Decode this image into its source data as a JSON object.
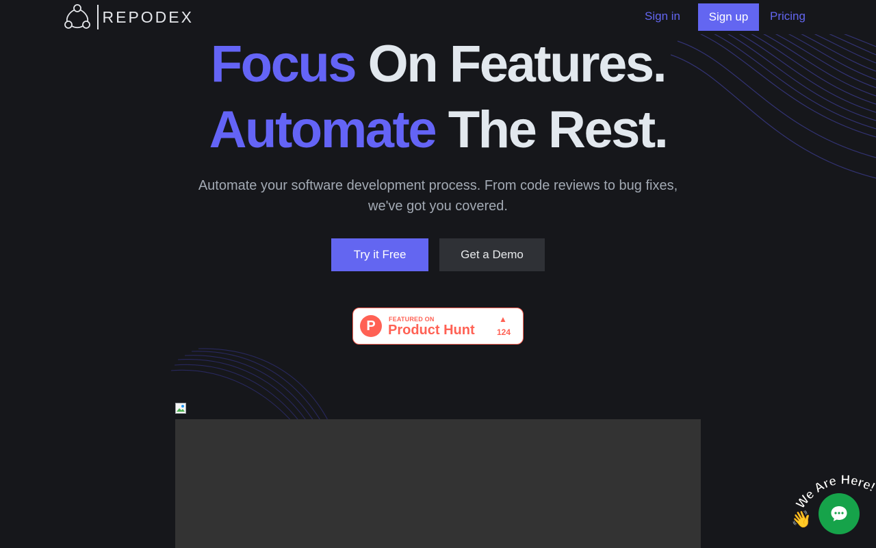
{
  "brand": {
    "name": "REPODEX"
  },
  "nav": {
    "sign_in": "Sign in",
    "sign_up": "Sign up",
    "pricing": "Pricing"
  },
  "hero": {
    "line1_accent": "Focus",
    "line1_rest": "On Features.",
    "line2_accent": "Automate",
    "line2_rest": "The Rest.",
    "subtitle_line1": "Automate your software development process. From code reviews to bug fixes,",
    "subtitle_line2": "we've got you covered."
  },
  "cta": {
    "primary_label": "Try it Free",
    "secondary_label": "Get a Demo"
  },
  "product_hunt": {
    "logo_letter": "P",
    "featured_label": "FEATURED ON",
    "title": "Product Hunt",
    "upvote_icon": "triangle-up-icon",
    "upvotes": "124"
  },
  "chat_widget": {
    "tagline": "We Are Here!",
    "hand_icon": "waving-hand-icon",
    "button_icon": "chat-bubble-icon"
  },
  "colors": {
    "background": "#16171b",
    "accent": "#6366f1",
    "product_hunt": "#ff6154",
    "chat": "#16a34a",
    "media_placeholder": "#333333"
  }
}
